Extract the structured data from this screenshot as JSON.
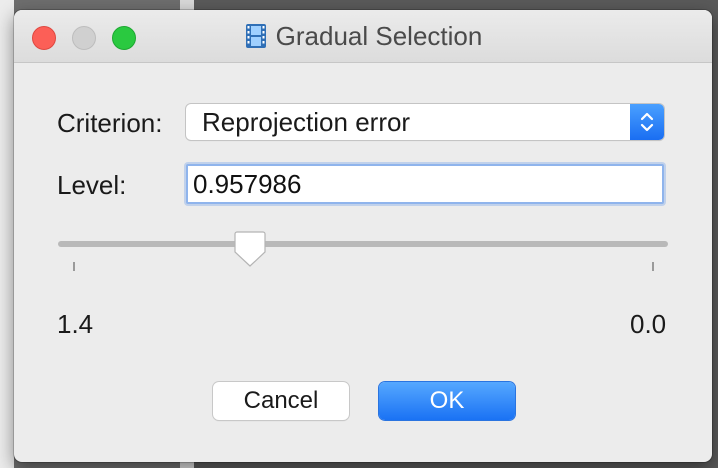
{
  "window": {
    "title": "Gradual Selection",
    "title_icon": "film-strip-icon"
  },
  "criterion": {
    "label": "Criterion:",
    "selected": "Reprojection error"
  },
  "level": {
    "label": "Level:",
    "value": "0.957986"
  },
  "slider": {
    "min_label": "1.4",
    "max_label": "0.0",
    "position_fraction": 0.315
  },
  "buttons": {
    "cancel": "Cancel",
    "ok": "OK"
  },
  "colors": {
    "accent": "#1a72f4",
    "close": "#fc5f57",
    "zoom": "#2ac940"
  }
}
